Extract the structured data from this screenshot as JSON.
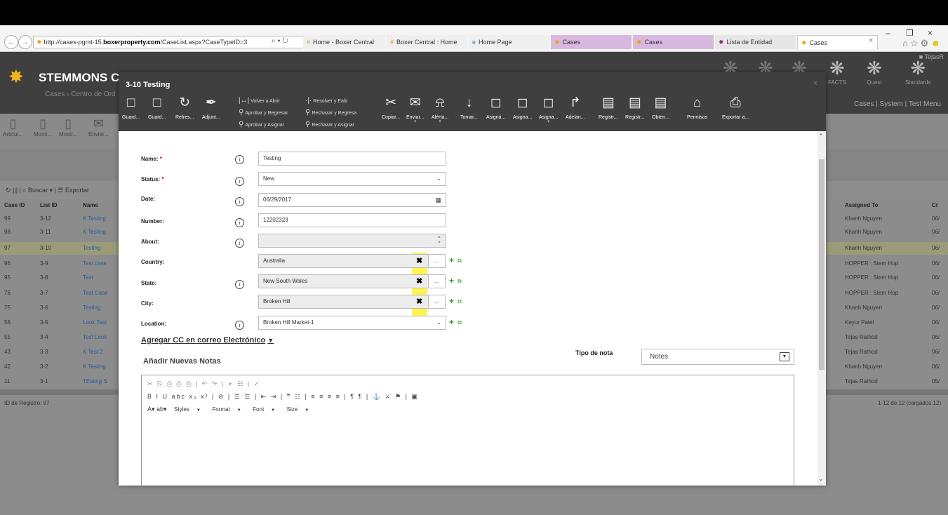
{
  "browser": {
    "url_prefix": "http://cases-pgmt-15.",
    "url_domain": "boxerproperty.com",
    "url_path": "/CaseList.aspx?CaseTypeID=3",
    "search_ctl": "⌕ ▾ ↻",
    "tabs": [
      {
        "label": "Home - Boxer Central",
        "icon": "#"
      },
      {
        "label": "Boxer Central : Home",
        "icon": "#"
      },
      {
        "label": "Home Page",
        "icon": "e"
      },
      {
        "label": "Cases",
        "icon": "✹"
      },
      {
        "label": "Cases",
        "icon": "✹"
      },
      {
        "label": "Lista de Entidad",
        "icon": "✹"
      },
      {
        "label": "Cases",
        "icon": "✹"
      }
    ],
    "user": "TejasR"
  },
  "app": {
    "logo_text": "STEMMONS CENTR",
    "breadcrumb": "Cases  ›  Centro de Ord",
    "top_icons": [
      "FACTS",
      "Quest",
      "Standards"
    ],
    "menu": "Cases  |  System  |  Test Menu",
    "bg_tools": [
      "Articul...",
      "Mostr...",
      "Mostr...",
      "Enviar..."
    ],
    "search_bar": "↻  |||  |  ⌕ Buscar ▾  |  ☰ Exportar",
    "columns": [
      "Case ID",
      "List ID",
      "Name",
      "Assigned To",
      "Cr"
    ],
    "rows": [
      {
        "id": "99",
        "list": "3-12",
        "name": "K Testing",
        "assigned": "Khanh Nguyen",
        "cr": "06/"
      },
      {
        "id": "98",
        "list": "3-11",
        "name": "K Testing",
        "assigned": "Khanh Nguyen",
        "cr": "06/"
      },
      {
        "id": "97",
        "list": "3-10",
        "name": "Testing",
        "assigned": "Khanh Nguyen",
        "cr": "06/"
      },
      {
        "id": "96",
        "list": "3-9",
        "name": "Test case",
        "assigned": "HOPPER : Stem Hop",
        "cr": "06/"
      },
      {
        "id": "95",
        "list": "3-8",
        "name": "Test",
        "assigned": "HOPPER : Stem Hop",
        "cr": "06/"
      },
      {
        "id": "76",
        "list": "3-7",
        "name": "Test Case",
        "assigned": "HOPPER : Stem Hop",
        "cr": "06/"
      },
      {
        "id": "75",
        "list": "3-6",
        "name": "Testing",
        "assigned": "Khanh Nguyen",
        "cr": "06/"
      },
      {
        "id": "56",
        "list": "3-5",
        "name": "Look Test",
        "assigned": "Keyur Patel",
        "cr": "06/"
      },
      {
        "id": "55",
        "list": "3-4",
        "name": "Test Look",
        "assigned": "Tejas Rathod",
        "cr": "06/"
      },
      {
        "id": "43",
        "list": "3-3",
        "name": "K Test 2",
        "assigned": "Tejas Rathod",
        "cr": "06/"
      },
      {
        "id": "42",
        "list": "3-2",
        "name": "K Testing",
        "assigned": "Khanh Nguyen",
        "cr": "06/"
      },
      {
        "id": "11",
        "list": "3-1",
        "name": "TEsting S",
        "assigned": "Tejas Rathod",
        "cr": "05/"
      }
    ],
    "record_id": "ID de Registro: 97",
    "paging": "1-12 de 12 (cargados 12)"
  },
  "modal": {
    "title": "3-10 Testing",
    "close": "×",
    "tools": [
      {
        "label": "Guard...",
        "icon": "□",
        "dd": ""
      },
      {
        "label": "Guard...",
        "icon": "□",
        "dd": ""
      },
      {
        "label": "Refres...",
        "icon": "↻",
        "dd": ""
      },
      {
        "label": "Adjunt...",
        "icon": "✒",
        "dd": ""
      },
      {
        "label": "Copiar...",
        "icon": "✂",
        "dd": ""
      },
      {
        "label": "Enviar...",
        "icon": "✉",
        "dd": "▾"
      },
      {
        "label": "Alérta...",
        "icon": "⍾",
        "dd": "▾"
      },
      {
        "label": "Tomar...",
        "icon": "↓",
        "dd": ""
      },
      {
        "label": "Asigná...",
        "icon": "◻",
        "dd": ""
      },
      {
        "label": "Asigna...",
        "icon": "◻",
        "dd": ""
      },
      {
        "label": "Asigna...",
        "icon": "◻",
        "dd": "▾"
      },
      {
        "label": "Adelan...",
        "icon": "↱",
        "dd": ""
      },
      {
        "label": "Registr...",
        "icon": "▤",
        "dd": ""
      },
      {
        "label": "Registr...",
        "icon": "▤",
        "dd": ""
      },
      {
        "label": "Obten...",
        "icon": "▤",
        "dd": ""
      },
      {
        "label": "Permisos",
        "icon": "⌂",
        "dd": ""
      },
      {
        "label": "Exportar a...",
        "icon": "⎙",
        "dd": ""
      }
    ],
    "text_tools": {
      "volver": "Volver a Abrir",
      "aprobar_regresar": "Aprobar y Regresar",
      "aprobar_asignar": "Aprobar y Asignar",
      "resolver": "Resolver y Ealir",
      "rechazar_regresa": "Rechazar y Regresa",
      "rechazar_asignar": "Rechazar y Asignar"
    },
    "form": {
      "name_label": "Name:",
      "name_value": "Testing",
      "status_label": "Status:",
      "status_value": "New",
      "date_label": "Date:",
      "date_value": "06/29/2017",
      "number_label": "Number:",
      "number_value": "12202323",
      "about_label": "About:",
      "about_value": "",
      "country_label": "Country:",
      "country_value": "Australia",
      "state_label": "State:",
      "state_value": "New South Wales",
      "city_label": "City:",
      "city_value": "Broken Hill",
      "location_label": "Location:",
      "location_value": "Broken Hill Market-1",
      "required_mark": "*",
      "dots": "..."
    },
    "cc_link": "Agregar CC en correo Electrónico",
    "notes_header": "Añadir Nuevas Notas",
    "tipo_nota_label": "Tipo de nota",
    "tipo_nota_value": "Notes",
    "editor": {
      "row1": "✂ ⎘ ⎙ ⎙ ⎙ | ↶ ↷ | ⎖ ☷ | ✓",
      "row2": "B I U abc x₂ x² | ⊘ | ☰ ☰ | ⇤ ⇥ | ❞ ☷ | ≡ ≡ ≡ ≡ | ¶ ¶ | ⚓ ⚔ ⚑ | ▣",
      "row3_colors": "A▾  ab▾",
      "styles": "Styles",
      "format": "Format",
      "font": "Font",
      "size": "Size"
    }
  }
}
